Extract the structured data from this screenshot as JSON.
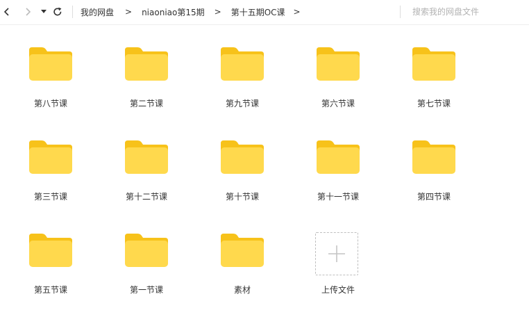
{
  "breadcrumb": {
    "items": [
      "我的网盘",
      "niaoniao第15期",
      "第十五期OC课"
    ],
    "separator": ">"
  },
  "search": {
    "placeholder": "搜索我的网盘文件"
  },
  "folders": [
    "第八节课",
    "第二节课",
    "第九节课",
    "第六节课",
    "第七节课",
    "第三节课",
    "第十二节课",
    "第十节课",
    "第十一节课",
    "第四节课",
    "第五节课",
    "第一节课",
    "素材"
  ],
  "upload": {
    "label": "上传文件"
  },
  "colors": {
    "folder_front": "#FFD94D",
    "folder_back": "#F7C21A",
    "text": "#333333"
  },
  "icons": {
    "back": "chevron-left-icon",
    "forward": "chevron-right-icon",
    "history": "caret-down-icon",
    "refresh": "refresh-icon",
    "folder": "folder-icon",
    "upload": "plus-icon"
  }
}
